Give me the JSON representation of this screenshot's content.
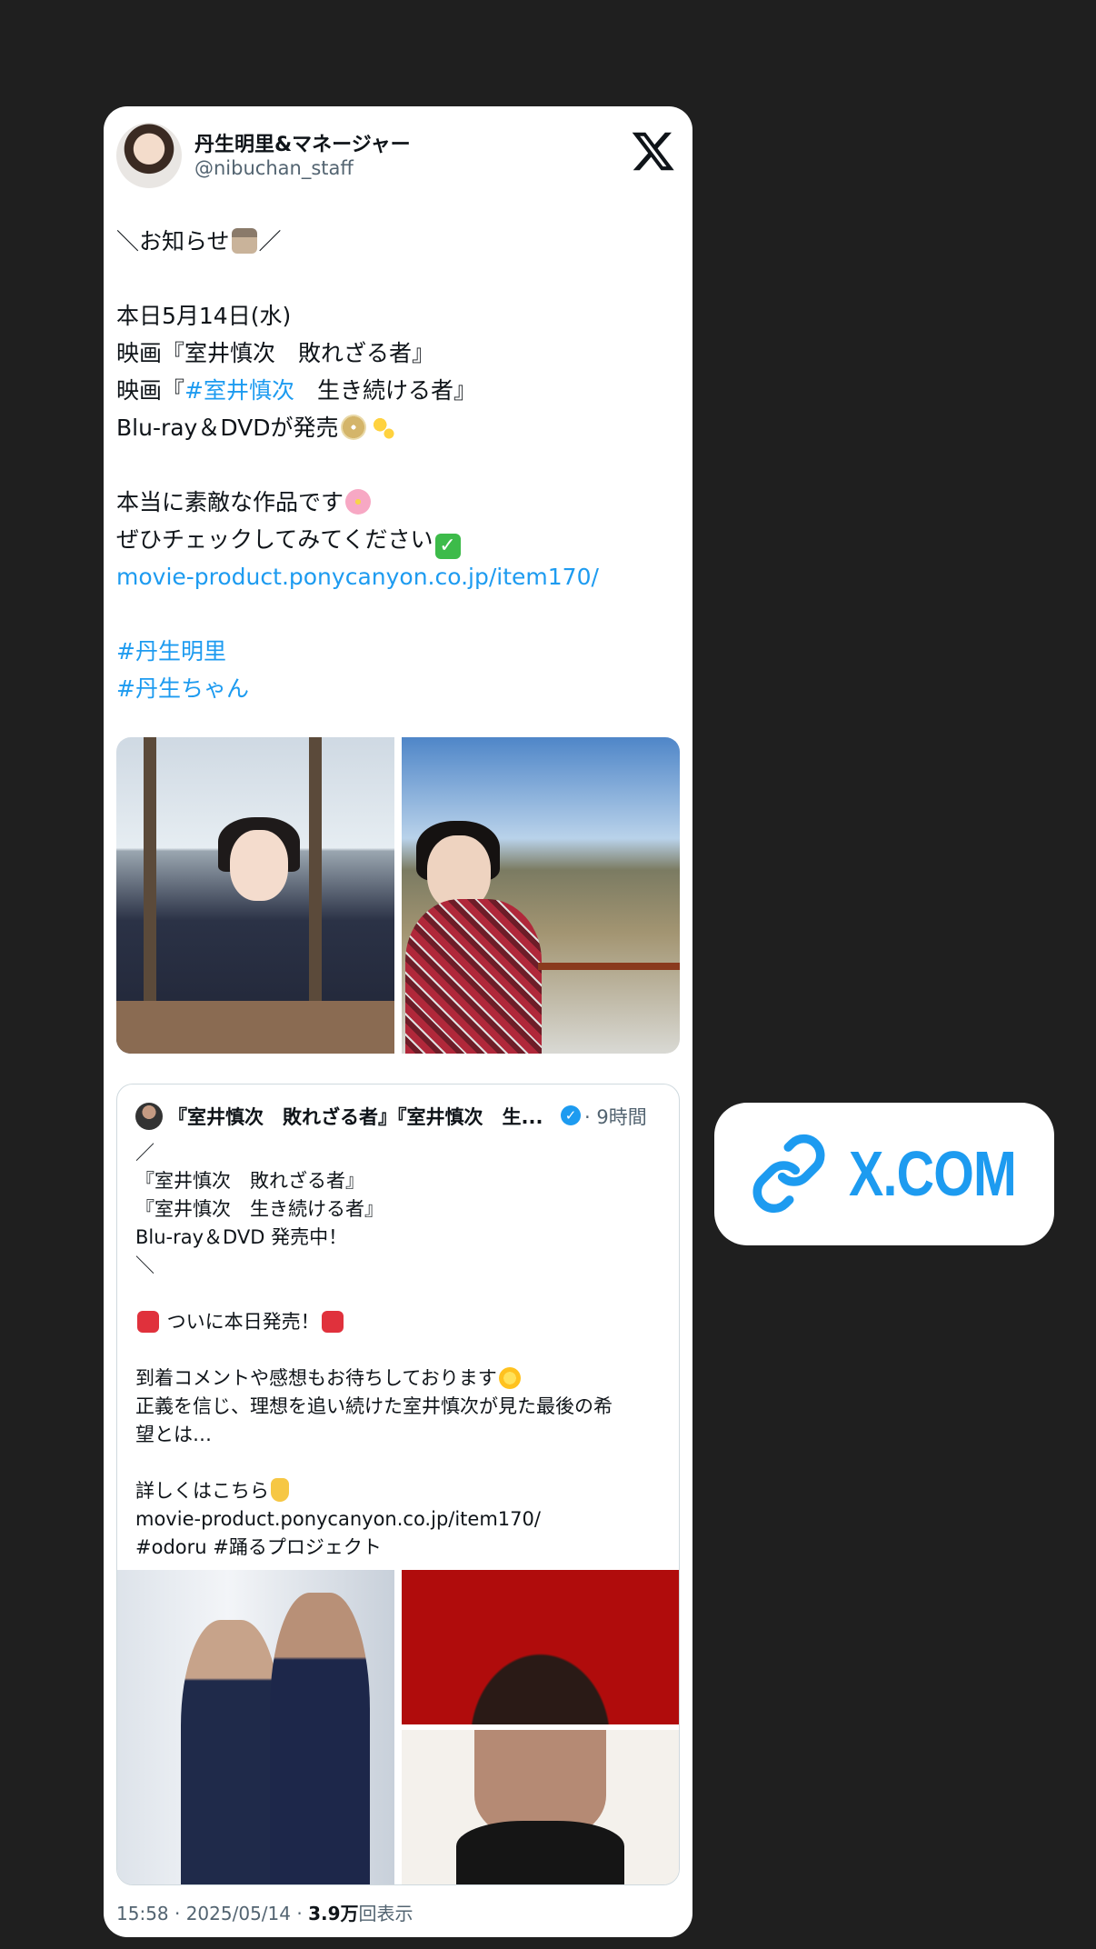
{
  "post": {
    "author_name": "丹生明里&マネージャー",
    "author_handle": "@nibuchan_staff",
    "lines": [
      "＼お知らせ",
      "",
      "本日5月14日(水)",
      "映画『室井慎次　敗れざる者』",
      "映画『",
      "#室井慎次",
      "　生き続ける者』",
      "Blu-ray＆DVDが発売",
      "",
      "本当に素敵な作品です",
      "ぜひチェックしてみてください",
      "movie-product.ponycanyon.co.jp/item170/",
      "",
      "#丹生明里",
      "#丹生ちゃん"
    ],
    "slash_end": "／"
  },
  "quoted": {
    "author_name": "『室井慎次　敗れざる者』『室井慎次　生...",
    "time": "· 9時間",
    "lines": [
      "／",
      "『室井慎次　敗れざる者』",
      "『室井慎次　生き続ける者』",
      "Blu-ray＆DVD 発売中！",
      "＼",
      "",
      " ついに本日発売！",
      "",
      "到着コメントや感想もお待ちしております",
      "正義を信じ、理想を追い続けた室井慎次が見た最後の希",
      "望とは…",
      "",
      "詳しくはこちら",
      "movie-product.ponycanyon.co.jp/item170/",
      "#odoru #踊るプロジェクト"
    ]
  },
  "footer": {
    "time_date": "15:58 · 2025/05/14 · ",
    "views_count": "3.9万",
    "views_label": "回表示"
  },
  "sticker": {
    "label": "X.COM"
  },
  "colors": {
    "accent": "#1d9bf0",
    "background": "#1f1f1f"
  }
}
